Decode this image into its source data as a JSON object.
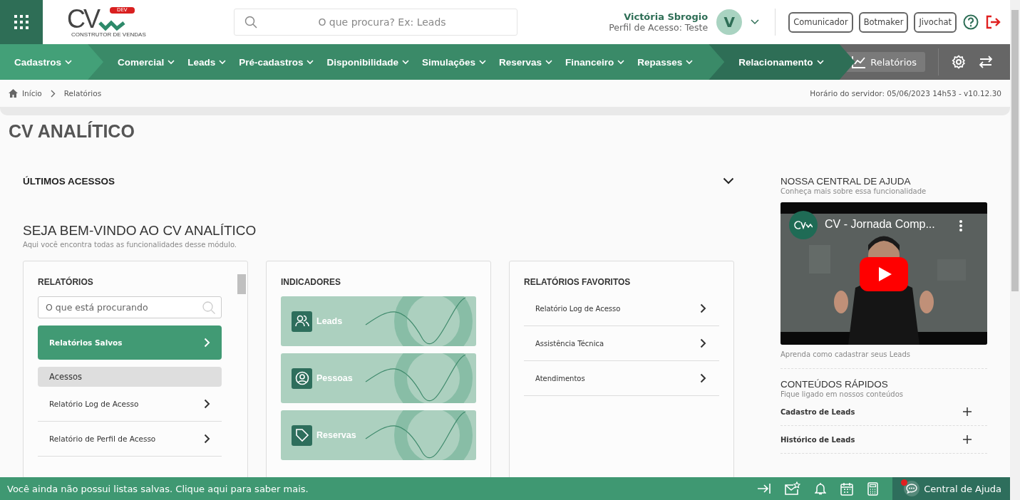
{
  "header": {
    "logo": {
      "letters": "CV",
      "badge": "DEV",
      "tagline": "CONSTRUTOR DE VENDAS"
    },
    "search": {
      "placeholder": "O que procura? Ex: Leads"
    },
    "user": {
      "name": "Victória Sbrogio",
      "profile": "Perfil de Acesso: Teste",
      "avatar": "V"
    },
    "buttons": [
      "Comunicador",
      "Botmaker",
      "Jivochat"
    ]
  },
  "nav": {
    "groups": [
      {
        "color": "#43a078",
        "items": [
          "Cadastros"
        ]
      },
      {
        "color": "#3a8a68",
        "items": [
          "Comercial",
          "Leads",
          "Pré-cadastros",
          "Disponibilidade",
          "Simulações",
          "Reservas",
          "Financeiro",
          "Repasses"
        ]
      },
      {
        "color": "#2e6e56",
        "items": [
          "Relacionamento"
        ]
      }
    ],
    "reports_button": "Relatórios"
  },
  "breadcrumb": {
    "items": [
      "Início",
      "Relatórios"
    ],
    "server_time": "Horário do servidor: 05/06/2023 14h53 - v10.12.30"
  },
  "page_title": "CV ANALÍTICO",
  "recent": {
    "title": "ÚLTIMOS ACESSOS",
    "expanded": false
  },
  "welcome": {
    "title": "SEJA BEM-VINDO AO CV ANALÍTICO",
    "subtitle": "Aqui você encontra todas as funcionalidades desse módulo."
  },
  "reports": {
    "title": "RELATÓRIOS",
    "search_placeholder": "O que está procurando",
    "items": [
      {
        "kind": "item",
        "label": "Relatórios Salvos",
        "selected": true
      },
      {
        "kind": "group",
        "label": "Acessos"
      },
      {
        "kind": "item",
        "label": "Relatório Log de Acesso",
        "selected": false
      },
      {
        "kind": "item",
        "label": "Relatório de Perfil de Acesso",
        "selected": false
      }
    ]
  },
  "indicators": {
    "title": "INDICADORES",
    "cards": [
      {
        "kind": "people",
        "label": "Leads"
      },
      {
        "kind": "person",
        "label": "Pessoas"
      },
      {
        "kind": "tag",
        "label": "Reservas"
      }
    ]
  },
  "favorites": {
    "title": "RELATÓRIOS FAVORITOS",
    "items": [
      "Relatório Log de Acesso",
      "Assistência Técnica",
      "Atendimentos"
    ]
  },
  "help": {
    "title": "NOSSA CENTRAL DE AJUDA",
    "subtitle": "Conheça mais sobre essa funcionalidade",
    "video_title": "CV - Jornada Comp...",
    "caption": "Aprenda como cadastrar seus Leads"
  },
  "quick": {
    "title": "CONTEÚDOS RÁPIDOS",
    "subtitle": "Fique ligado em nossos conteúdos",
    "items": [
      {
        "label": "Cadastro de Leads",
        "expanded": false
      },
      {
        "label": "Histórico de Leads",
        "expanded": false
      }
    ]
  },
  "footer": {
    "message": "Você ainda não possui listas salvas. Clique aqui para saber mais.",
    "help_button": "Central de Ajuda",
    "notification": true
  }
}
